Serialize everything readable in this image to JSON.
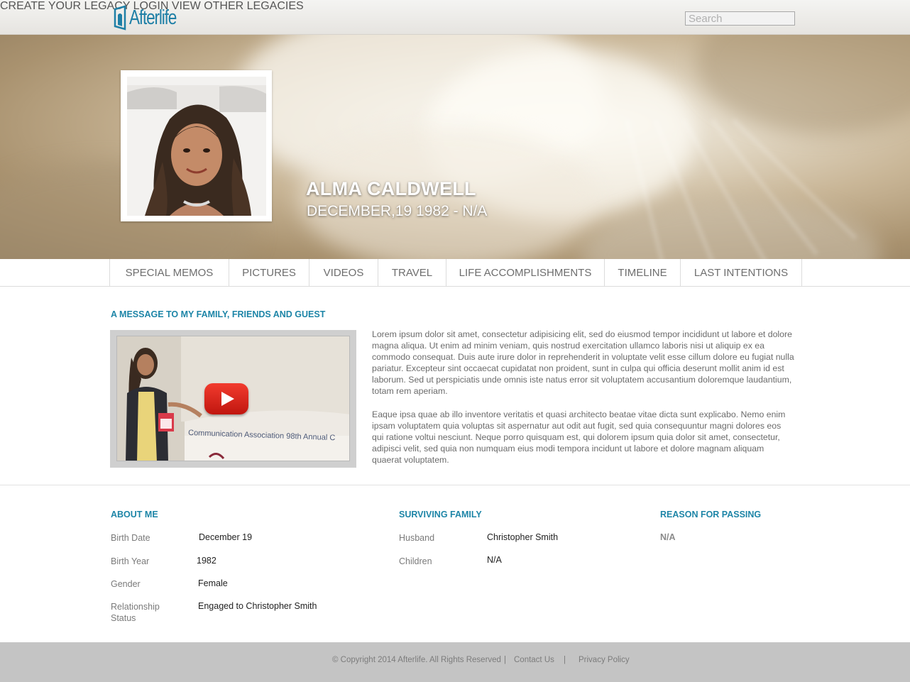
{
  "header": {
    "logo_text": "Afterlife",
    "nav": [
      {
        "label": "CREATE YOUR LEGACY"
      },
      {
        "label": "LOGIN"
      },
      {
        "label": "VIEW OTHER LEGACIES"
      }
    ],
    "search_placeholder": "Search"
  },
  "hero": {
    "name": "ALMA CALDWELL",
    "dates": "DECEMBER,19 1982 - N/A"
  },
  "tabs": [
    {
      "label": "SPECIAL MEMOS"
    },
    {
      "label": "PICTURES"
    },
    {
      "label": "VIDEOS"
    },
    {
      "label": "TRAVEL"
    },
    {
      "label": "LIFE ACCOMPLISHMENTS"
    },
    {
      "label": "TIMELINE"
    },
    {
      "label": "LAST INTENTIONS"
    }
  ],
  "message": {
    "title": "A MESSAGE TO MY FAMILY, FRIENDS AND GUEST",
    "video_caption": "Communication Association 98th Annual C",
    "paragraph1": "Lorem ipsum dolor sit amet, consectetur adipisicing elit, sed do eiusmod tempor incididunt ut labore et dolore magna aliqua. Ut enim ad minim veniam, quis nostrud exercitation ullamco laboris nisi ut aliquip ex ea commodo consequat. Duis aute irure dolor in reprehenderit in voluptate velit esse cillum dolore eu fugiat nulla pariatur. Excepteur sint occaecat cupidatat non proident, sunt in culpa qui officia deserunt mollit anim id est laborum. Sed ut perspiciatis unde omnis iste natus error sit voluptatem accusantium doloremque laudantium, totam rem aperiam.",
    "paragraph2": "Eaque ipsa quae ab illo inventore veritatis et quasi architecto beatae vitae dicta sunt explicabo. Nemo enim ipsam voluptatem quia voluptas sit aspernatur aut odit aut fugit, sed quia consequuntur magni dolores eos qui ratione voltui nesciunt. Neque porro quisquam est, qui dolorem ipsum quia dolor sit amet, consectetur, adipisci velit, sed quia non numquam eius modi tempora incidunt ut labore et dolore magnam aliquam quaerat voluptatem."
  },
  "about": {
    "title": "ABOUT ME",
    "birth_date_label": "Birth Date",
    "birth_date": "December 19",
    "birth_year_label": "Birth Year",
    "birth_year": "1982",
    "gender_label": "Gender",
    "gender": "Female",
    "relationship_label": "Relationship Status",
    "relationship": "Engaged to Christopher Smith"
  },
  "family": {
    "title": "SURVIVING FAMILY",
    "husband_label": "Husband",
    "husband": "Christopher Smith",
    "children_label": "Children",
    "children": "N/A"
  },
  "passing": {
    "title": "REASON FOR PASSING",
    "value": "N/A"
  },
  "footer": {
    "copyright": "© Copyright 2014 Afterlife. All Rights Reserved",
    "separator": "|",
    "contact": "Contact Us",
    "privacy": "Privacy Policy"
  },
  "colors": {
    "accent": "#1d85a7",
    "logo": "#1e7fa6",
    "footer_bg": "#c4c4c4",
    "play_red": "#e0261c"
  }
}
